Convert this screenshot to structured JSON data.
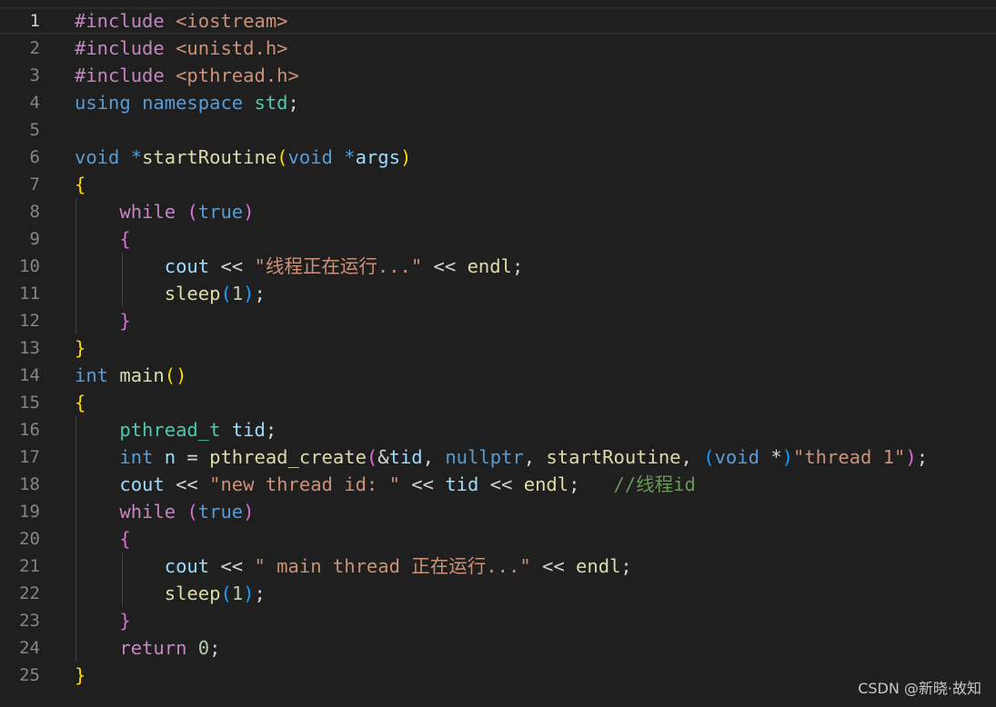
{
  "editor": {
    "lines": [
      {
        "n": "1",
        "tokens": [
          {
            "t": "#include",
            "c": "pp"
          },
          {
            "t": " "
          },
          {
            "t": "<iostream>",
            "c": "inc"
          }
        ]
      },
      {
        "n": "2",
        "tokens": [
          {
            "t": "#include",
            "c": "pp"
          },
          {
            "t": " "
          },
          {
            "t": "<unistd.h>",
            "c": "inc"
          }
        ]
      },
      {
        "n": "3",
        "tokens": [
          {
            "t": "#include",
            "c": "pp"
          },
          {
            "t": " "
          },
          {
            "t": "<pthread.h>",
            "c": "inc"
          }
        ]
      },
      {
        "n": "4",
        "tokens": [
          {
            "t": "using",
            "c": "kw-type"
          },
          {
            "t": " "
          },
          {
            "t": "namespace",
            "c": "kw-type"
          },
          {
            "t": " "
          },
          {
            "t": "std",
            "c": "kw-ns"
          },
          {
            "t": ";",
            "c": "plain"
          }
        ]
      },
      {
        "n": "5",
        "tokens": []
      },
      {
        "n": "6",
        "tokens": [
          {
            "t": "void",
            "c": "kw-type"
          },
          {
            "t": " "
          },
          {
            "t": "*",
            "c": "kw-type"
          },
          {
            "t": "startRoutine",
            "c": "fn"
          },
          {
            "t": "(",
            "c": "b1"
          },
          {
            "t": "void",
            "c": "kw-type"
          },
          {
            "t": " "
          },
          {
            "t": "*",
            "c": "kw-type"
          },
          {
            "t": "args",
            "c": "var"
          },
          {
            "t": ")",
            "c": "b1"
          }
        ]
      },
      {
        "n": "7",
        "tokens": [
          {
            "t": "{",
            "c": "b1"
          }
        ]
      },
      {
        "n": "8",
        "tokens": [
          {
            "t": "    "
          },
          {
            "t": "while",
            "c": "kw-ctl"
          },
          {
            "t": " "
          },
          {
            "t": "(",
            "c": "b2"
          },
          {
            "t": "true",
            "c": "kw-type"
          },
          {
            "t": ")",
            "c": "b2"
          }
        ]
      },
      {
        "n": "9",
        "tokens": [
          {
            "t": "    "
          },
          {
            "t": "{",
            "c": "b2"
          }
        ]
      },
      {
        "n": "10",
        "tokens": [
          {
            "t": "        "
          },
          {
            "t": "cout",
            "c": "var"
          },
          {
            "t": " << ",
            "c": "plain"
          },
          {
            "t": "\"线程正在运行...\"",
            "c": "str"
          },
          {
            "t": " << ",
            "c": "plain"
          },
          {
            "t": "endl",
            "c": "fn"
          },
          {
            "t": ";",
            "c": "plain"
          }
        ]
      },
      {
        "n": "11",
        "tokens": [
          {
            "t": "        "
          },
          {
            "t": "sleep",
            "c": "fn"
          },
          {
            "t": "(",
            "c": "b3"
          },
          {
            "t": "1",
            "c": "num"
          },
          {
            "t": ")",
            "c": "b3"
          },
          {
            "t": ";",
            "c": "plain"
          }
        ]
      },
      {
        "n": "12",
        "tokens": [
          {
            "t": "    "
          },
          {
            "t": "}",
            "c": "b2"
          }
        ]
      },
      {
        "n": "13",
        "tokens": [
          {
            "t": "}",
            "c": "b1"
          }
        ]
      },
      {
        "n": "14",
        "tokens": [
          {
            "t": "int",
            "c": "kw-type"
          },
          {
            "t": " "
          },
          {
            "t": "main",
            "c": "fn"
          },
          {
            "t": "()",
            "c": "b1"
          }
        ]
      },
      {
        "n": "15",
        "tokens": [
          {
            "t": "{",
            "c": "b1"
          }
        ]
      },
      {
        "n": "16",
        "tokens": [
          {
            "t": "    "
          },
          {
            "t": "pthread_t",
            "c": "kw-ns"
          },
          {
            "t": " "
          },
          {
            "t": "tid",
            "c": "var"
          },
          {
            "t": ";",
            "c": "plain"
          }
        ]
      },
      {
        "n": "17",
        "tokens": [
          {
            "t": "    "
          },
          {
            "t": "int",
            "c": "kw-type"
          },
          {
            "t": " "
          },
          {
            "t": "n",
            "c": "var"
          },
          {
            "t": " = ",
            "c": "plain"
          },
          {
            "t": "pthread_create",
            "c": "fn"
          },
          {
            "t": "(",
            "c": "b2"
          },
          {
            "t": "&",
            "c": "plain"
          },
          {
            "t": "tid",
            "c": "var"
          },
          {
            "t": ", ",
            "c": "plain"
          },
          {
            "t": "nullptr",
            "c": "kw-type"
          },
          {
            "t": ", ",
            "c": "plain"
          },
          {
            "t": "startRoutine",
            "c": "fn"
          },
          {
            "t": ", ",
            "c": "plain"
          },
          {
            "t": "(",
            "c": "b3"
          },
          {
            "t": "void",
            "c": "kw-type"
          },
          {
            "t": " *",
            "c": "plain"
          },
          {
            "t": ")",
            "c": "b3"
          },
          {
            "t": "\"thread 1\"",
            "c": "str"
          },
          {
            "t": ")",
            "c": "b2"
          },
          {
            "t": ";",
            "c": "plain"
          }
        ]
      },
      {
        "n": "18",
        "tokens": [
          {
            "t": "    "
          },
          {
            "t": "cout",
            "c": "var"
          },
          {
            "t": " << ",
            "c": "plain"
          },
          {
            "t": "\"new thread id: \"",
            "c": "str"
          },
          {
            "t": " << ",
            "c": "plain"
          },
          {
            "t": "tid",
            "c": "var"
          },
          {
            "t": " << ",
            "c": "plain"
          },
          {
            "t": "endl",
            "c": "fn"
          },
          {
            "t": ";",
            "c": "plain"
          },
          {
            "t": "   "
          },
          {
            "t": "//线程id",
            "c": "cmt"
          }
        ]
      },
      {
        "n": "19",
        "tokens": [
          {
            "t": "    "
          },
          {
            "t": "while",
            "c": "kw-ctl"
          },
          {
            "t": " "
          },
          {
            "t": "(",
            "c": "b2"
          },
          {
            "t": "true",
            "c": "kw-type"
          },
          {
            "t": ")",
            "c": "b2"
          }
        ]
      },
      {
        "n": "20",
        "tokens": [
          {
            "t": "    "
          },
          {
            "t": "{",
            "c": "b2"
          }
        ]
      },
      {
        "n": "21",
        "tokens": [
          {
            "t": "        "
          },
          {
            "t": "cout",
            "c": "var"
          },
          {
            "t": " << ",
            "c": "plain"
          },
          {
            "t": "\" main thread 正在运行...\"",
            "c": "str"
          },
          {
            "t": " << ",
            "c": "plain"
          },
          {
            "t": "endl",
            "c": "fn"
          },
          {
            "t": ";",
            "c": "plain"
          }
        ]
      },
      {
        "n": "22",
        "tokens": [
          {
            "t": "        "
          },
          {
            "t": "sleep",
            "c": "fn"
          },
          {
            "t": "(",
            "c": "b3"
          },
          {
            "t": "1",
            "c": "num"
          },
          {
            "t": ")",
            "c": "b3"
          },
          {
            "t": ";",
            "c": "plain"
          }
        ]
      },
      {
        "n": "23",
        "tokens": [
          {
            "t": "    "
          },
          {
            "t": "}",
            "c": "b2"
          }
        ]
      },
      {
        "n": "24",
        "tokens": [
          {
            "t": "    "
          },
          {
            "t": "return",
            "c": "kw-ctl"
          },
          {
            "t": " "
          },
          {
            "t": "0",
            "c": "num"
          },
          {
            "t": ";",
            "c": "plain"
          }
        ]
      },
      {
        "n": "25",
        "tokens": [
          {
            "t": "}",
            "c": "b1"
          }
        ]
      }
    ]
  },
  "watermark": "CSDN @新晓·故知"
}
